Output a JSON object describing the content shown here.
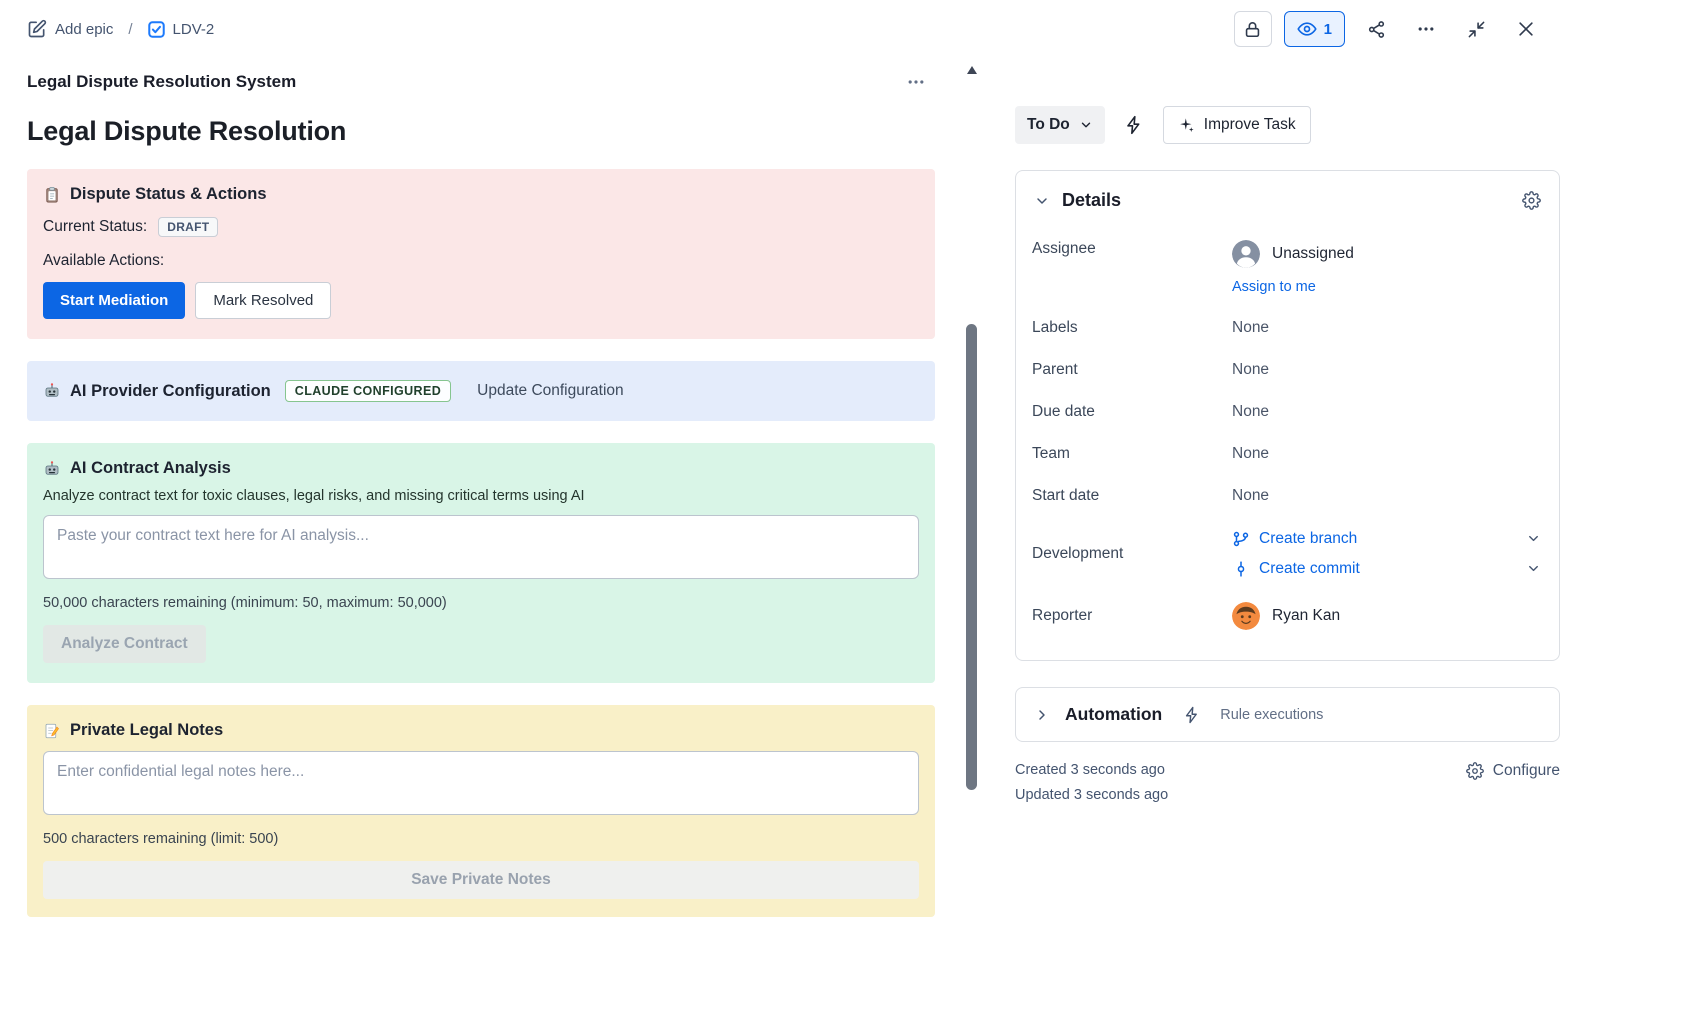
{
  "theme": {
    "accent": "#0C66E4",
    "panel_pink": "#FBE7E7",
    "panel_blue": "#E4ECFB",
    "panel_green": "#D9F5E7",
    "panel_yellow": "#F9F0C8",
    "badge_green_border": "#86C58F"
  },
  "breadcrumb": {
    "add_epic": "Add epic",
    "separator": "/",
    "issue_key": "LDV-2",
    "icons": [
      "edit-icon",
      "task-type-icon"
    ]
  },
  "top_actions": {
    "watch_count": "1",
    "icons": [
      "lock-icon",
      "watch-icon",
      "share-icon",
      "more-options-icon",
      "collapse-icon",
      "close-icon"
    ]
  },
  "content": {
    "header_title": "Legal Dispute Resolution System",
    "title": "Legal Dispute Resolution",
    "dispute_panel": {
      "icon": "clipboard-icon",
      "title": "Dispute Status & Actions",
      "current_status_label": "Current Status:",
      "status_badge": "DRAFT",
      "available_actions_label": "Available Actions:",
      "start_mediation_button": "Start Mediation",
      "mark_resolved_button": "Mark Resolved"
    },
    "provider_panel": {
      "icon": "robot-icon",
      "title": "AI Provider Configuration",
      "badge": "CLAUDE CONFIGURED",
      "update_link": "Update Configuration"
    },
    "analysis_panel": {
      "icon": "robot-icon",
      "title": "AI Contract Analysis",
      "description": "Analyze contract text for toxic clauses, legal risks, and missing critical terms using AI",
      "textarea_placeholder": "Paste your contract text here for AI analysis...",
      "char_info": "50,000 characters remaining (minimum: 50, maximum: 50,000)",
      "analyze_button": "Analyze Contract"
    },
    "notes_panel": {
      "icon": "memo-icon",
      "title": "Private Legal Notes",
      "textarea_placeholder": "Enter confidential legal notes here...",
      "char_info": "500 characters remaining (limit: 500)",
      "save_button": "Save Private Notes"
    }
  },
  "sidebar": {
    "status_button": "To Do",
    "improve_task_button": "Improve Task",
    "details": {
      "title": "Details",
      "assignee": {
        "label": "Assignee",
        "value": "Unassigned",
        "action": "Assign to me"
      },
      "simple_fields": [
        {
          "label": "Labels",
          "value": "None"
        },
        {
          "label": "Parent",
          "value": "None"
        },
        {
          "label": "Due date",
          "value": "None"
        },
        {
          "label": "Team",
          "value": "None"
        },
        {
          "label": "Start date",
          "value": "None"
        }
      ],
      "development": {
        "label": "Development",
        "actions": [
          "Create branch",
          "Create commit"
        ]
      },
      "reporter": {
        "label": "Reporter",
        "value": "Ryan Kan"
      }
    },
    "automation": {
      "title": "Automation",
      "subtitle": "Rule executions"
    },
    "footer": {
      "created": "Created 3 seconds ago",
      "updated": "Updated 3 seconds ago",
      "configure": "Configure"
    }
  }
}
